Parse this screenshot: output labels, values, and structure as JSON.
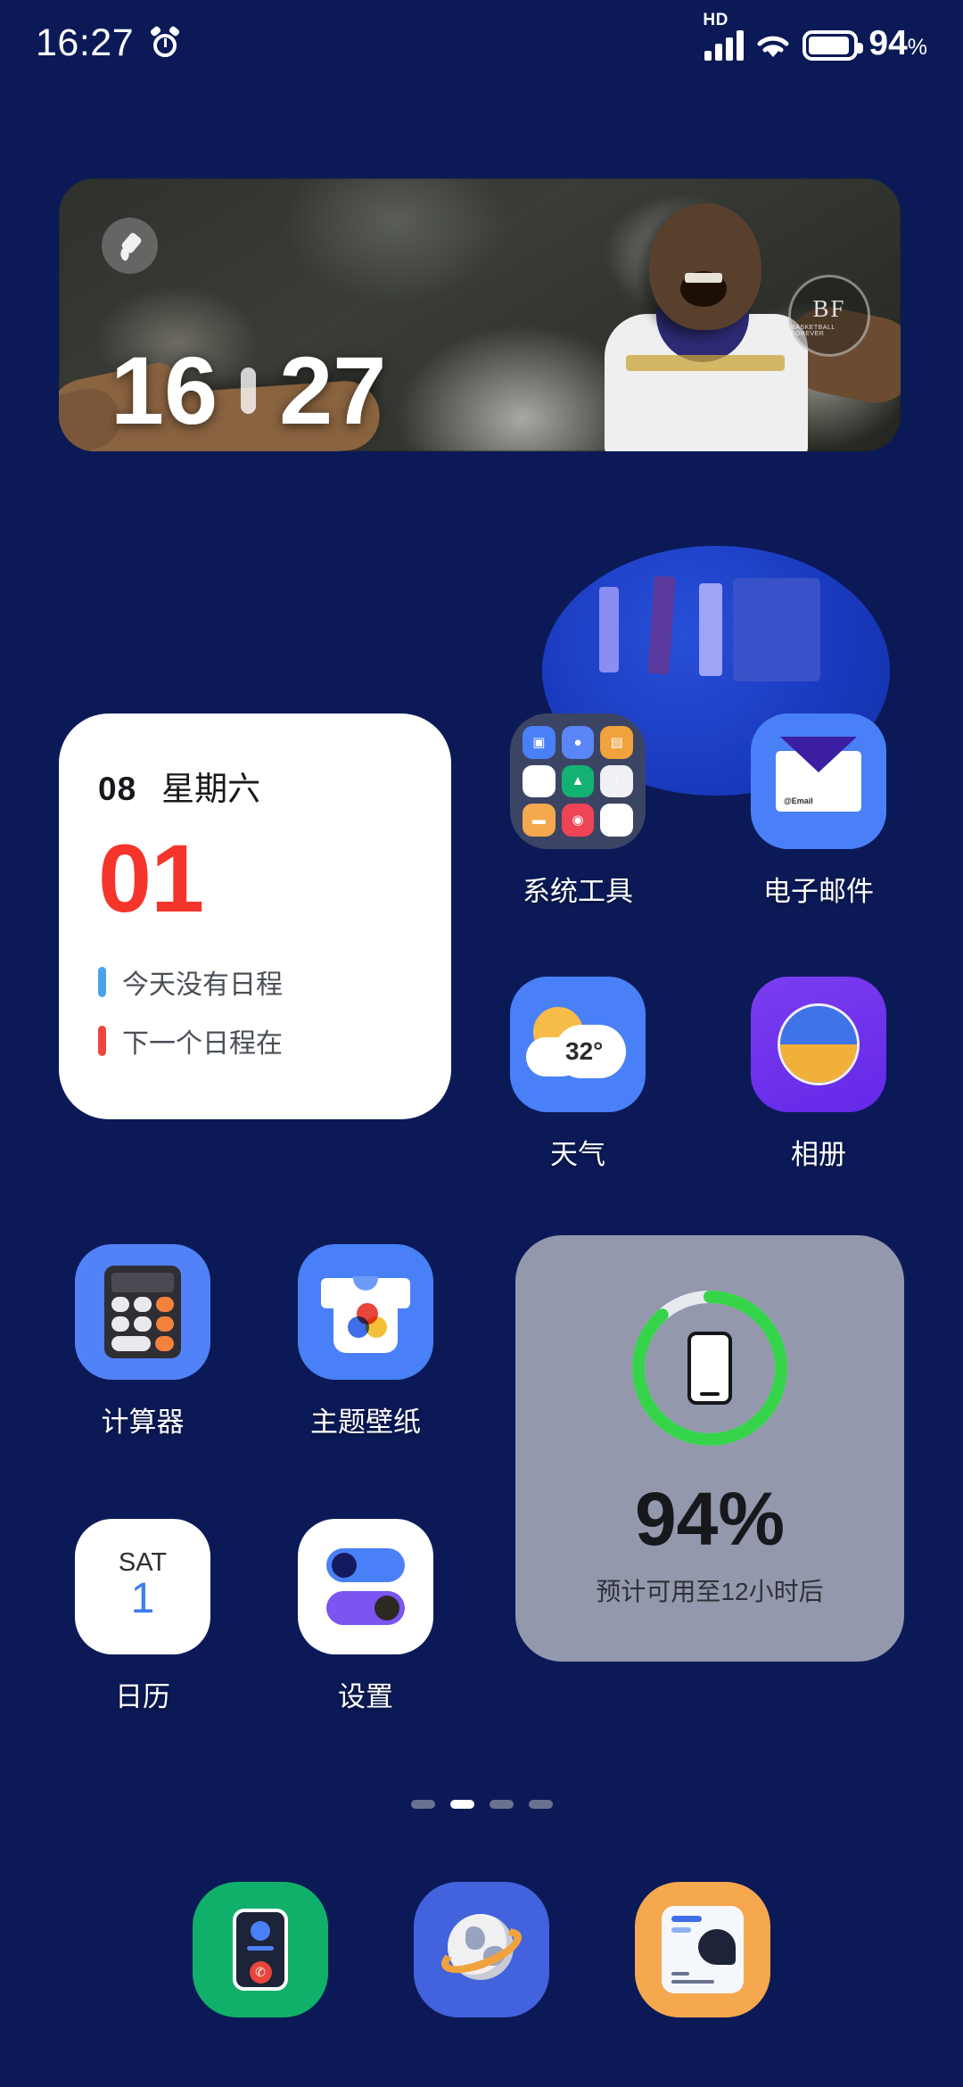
{
  "status_bar": {
    "time": "16:27",
    "alarm_icon": "alarm-clock-icon",
    "hd_label": "HD",
    "signal_icon": "cellular-signal-icon",
    "wifi_icon": "wifi-icon",
    "battery_icon": "battery-icon",
    "battery_percent": "94",
    "percent_symbol": "%"
  },
  "photo_widget": {
    "edit_icon": "pencil-edit-icon",
    "clock_hours": "16",
    "clock_minutes": "27",
    "stamp_text": "BF",
    "stamp_sub": "BASKETBALL FOREVER"
  },
  "calendar_widget": {
    "month": "08",
    "day_of_week": "星期六",
    "day_number": "01",
    "events": [
      {
        "text": "今天没有日程",
        "color": "#4aa3e8"
      },
      {
        "text": "下一个日程在",
        "color": "#f0453c"
      }
    ]
  },
  "apps": {
    "system_tools": {
      "label": "系统工具",
      "icon": "folder-icon"
    },
    "email": {
      "label": "电子邮件",
      "icon": "envelope-icon",
      "tag": "@Email"
    },
    "weather": {
      "label": "天气",
      "icon": "sun-cloud-icon",
      "temperature": "32°"
    },
    "gallery": {
      "label": "相册",
      "icon": "gallery-circle-icon"
    },
    "calculator": {
      "label": "计算器",
      "icon": "calculator-icon"
    },
    "themes": {
      "label": "主题壁纸",
      "icon": "tshirt-icon"
    },
    "calendar": {
      "label": "日历",
      "icon": "calendar-icon",
      "day_abbr": "SAT",
      "date": "1"
    },
    "settings": {
      "label": "设置",
      "icon": "toggles-icon"
    }
  },
  "folder_mini_icons": [
    {
      "name": "app-store-icon",
      "bg": "#4a80f7",
      "glyph": "▣"
    },
    {
      "name": "camera-icon",
      "bg": "#5a86f8",
      "glyph": "●"
    },
    {
      "name": "notes-icon",
      "bg": "#f0a23c",
      "glyph": "▤"
    },
    {
      "name": "qr-scanner-icon",
      "bg": "#ffffff",
      "glyph": "▦"
    },
    {
      "name": "weather-icon",
      "bg": "#14b272",
      "glyph": "▲"
    },
    {
      "name": "music-icon",
      "bg": "#f0f0f5",
      "glyph": "♪"
    },
    {
      "name": "tools-icon",
      "bg": "#f5a84e",
      "glyph": "🔧"
    },
    {
      "name": "compass-icon",
      "bg": "#ef4455",
      "glyph": "◉"
    },
    {
      "name": "phone-manager-icon",
      "bg": "#ffffff",
      "glyph": "◐"
    }
  ],
  "battery_widget": {
    "percent_label": "94%",
    "percent_value": 94,
    "estimate_text": "预计可用至12小时后",
    "ring_color": "#35d44a",
    "card_color": "#9398ad",
    "phone_icon": "phone-outline-icon"
  },
  "page_indicator": {
    "total": 4,
    "active_index": 1
  },
  "dock": [
    {
      "label": "phone",
      "icon": "phone-call-icon",
      "color": "#11b06a"
    },
    {
      "label": "browser",
      "icon": "globe-browser-icon",
      "color": "#4263dd"
    },
    {
      "label": "messages",
      "icon": "message-bubble-icon",
      "color": "#f5a84e"
    }
  ],
  "theme": {
    "wallpaper": "#0b1a57",
    "accent_blue": "#4a80f7",
    "accent_red": "#f5352b",
    "accent_green": "#35d44a"
  }
}
